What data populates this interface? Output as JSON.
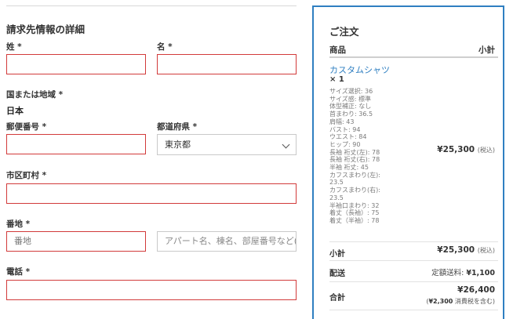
{
  "billing": {
    "title": "請求先情報の詳細",
    "last_name_label": "姓 *",
    "first_name_label": "名 *",
    "country_label": "国または地域 *",
    "country_value": "日本",
    "postcode_label": "郵便番号 *",
    "prefecture_label": "都道府県 *",
    "prefecture_value": "東京都",
    "city_label": "市区町村 *",
    "address_label": "番地 *",
    "address1_placeholder": "番地",
    "address2_placeholder": "アパート名、棟名、部屋番号など(",
    "phone_label": "電話 *"
  },
  "order": {
    "title": "ご注文",
    "col_product": "商品",
    "col_subtotal": "小計",
    "product_name": "カスタムシャツ",
    "product_qty": "× 1",
    "specs": [
      "サイズ選択: 36",
      "サイズ感: 標準",
      "体型補正: なし",
      "首まわり: 36.5",
      "肩幅: 43",
      "バスト: 94",
      "ウエスト: 84",
      "ヒップ: 90",
      "長袖 裄丈(左): 78",
      "長袖 裄丈(右): 78",
      "半袖 裄丈: 45",
      "カフスまわり(左):",
      "23.5",
      "カフスまわり(右):",
      "23.5",
      "半袖口まわり: 32",
      "着丈（長袖）: 75",
      "着丈（半袖）: 78"
    ],
    "product_price": "¥25,300",
    "tax_note": "(税込)",
    "subtotal_label": "小計",
    "subtotal_value": "¥25,300",
    "shipping_label": "配送",
    "shipping_text": "定額送料:",
    "shipping_value": "¥1,100",
    "total_label": "合計",
    "total_value": "¥26,400",
    "tax_open": "(",
    "tax_amount": "¥2,300",
    "tax_close": " 消費税を含む)"
  }
}
